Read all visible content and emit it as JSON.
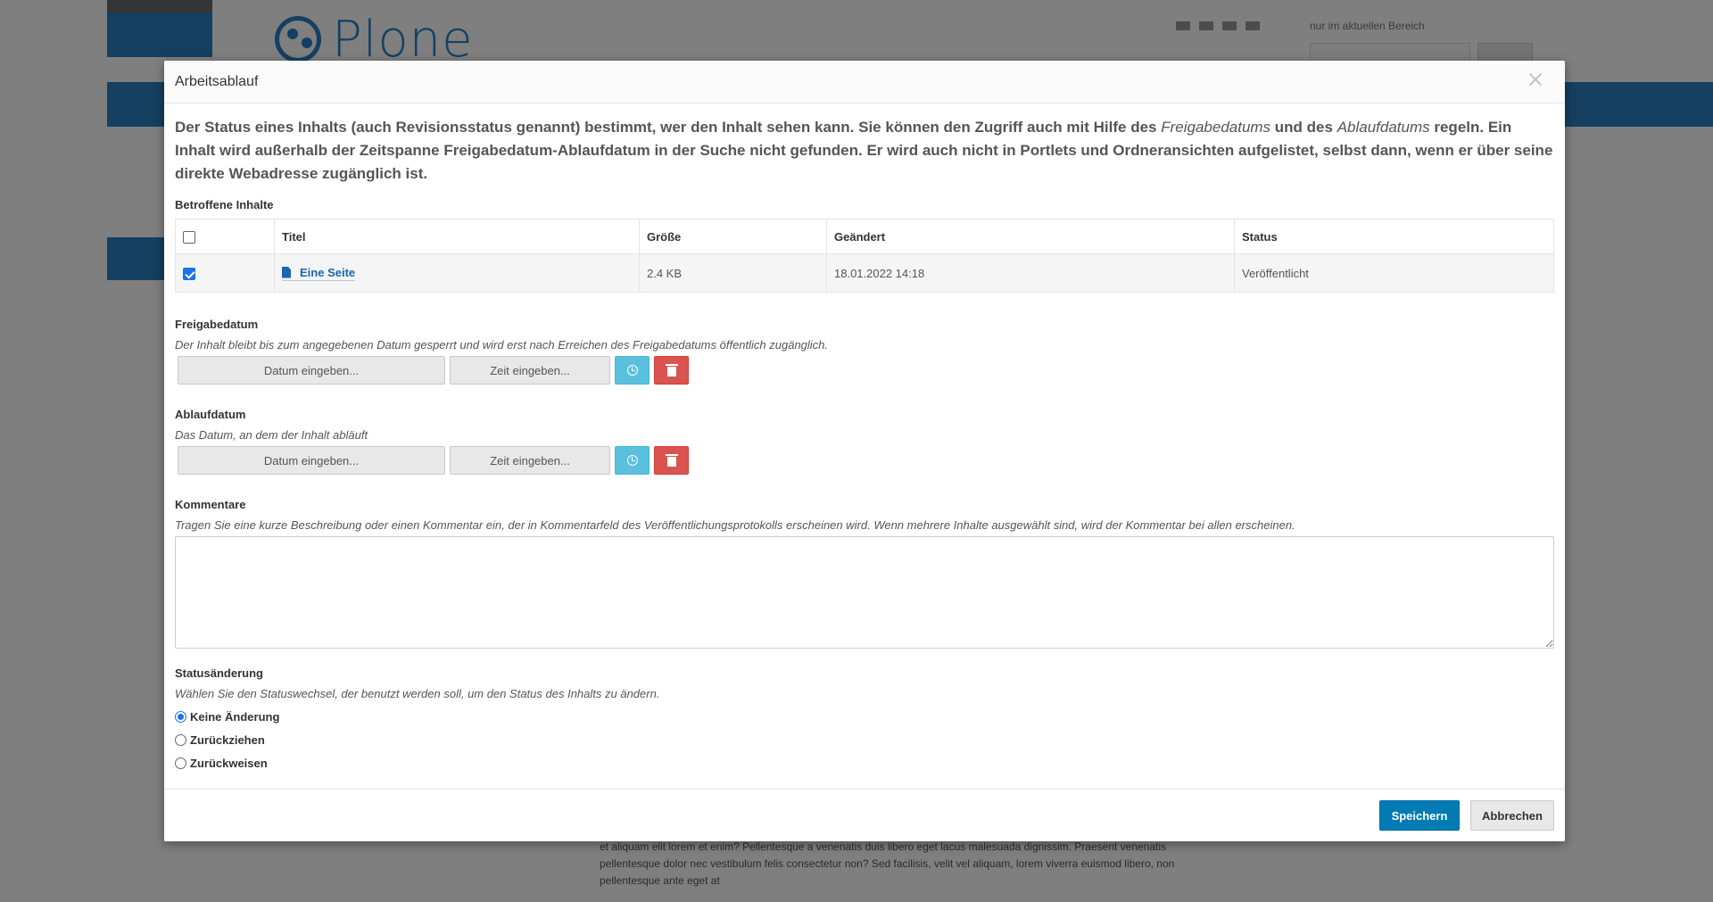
{
  "background": {
    "logo_text": "Plone",
    "site_option_text": "nur im aktuellen Bereich",
    "body_text": "et aliquam elit lorem et enim? Pellentesque a venenatis duis libero eget lacus malesuada dignissim. Praesent venenatis pellentesque dolor nec vestibulum felis consectetur non? Sed facilisis, velit vel aliquam, lorem viverra euismod libero, non pellentesque ante eget at"
  },
  "modal": {
    "title": "Arbeitsablauf",
    "intro_part1": "Der Status eines Inhalts (auch Revisionsstatus genannt) bestimmt, wer den Inhalt sehen kann. Sie können den Zugriff auch mit Hilfe des ",
    "intro_em1": "Freigabedatums",
    "intro_part2": " und des ",
    "intro_em2": "Ablaufdatums",
    "intro_part3": " regeln. Ein Inhalt wird außerhalb der Zeitspanne Freigabedatum-Ablaufdatum in der Suche nicht gefunden. Er wird auch nicht in Portlets und Ordneransichten aufgelistet, selbst dann, wenn er über seine direkte Webadresse zugänglich ist.",
    "affected": {
      "label": "Betroffene Inhalte",
      "columns": [
        "Titel",
        "Größe",
        "Geändert",
        "Status"
      ],
      "rows": [
        {
          "title": "Eine Seite",
          "size": "2.4 KB",
          "modified": "18.01.2022 14:18",
          "status": "Veröffentlicht",
          "checked": true
        }
      ]
    },
    "effective": {
      "label": "Freigabedatum",
      "help": "Der Inhalt bleibt bis zum angegebenen Datum gesperrt und wird erst nach Erreichen des Freigabedatums öffentlich zugänglich.",
      "date_placeholder": "Datum eingeben...",
      "time_placeholder": "Zeit eingeben..."
    },
    "expiration": {
      "label": "Ablaufdatum",
      "help": "Das Datum, an dem der Inhalt abläuft",
      "date_placeholder": "Datum eingeben...",
      "time_placeholder": "Zeit eingeben..."
    },
    "comments": {
      "label": "Kommentare",
      "help": "Tragen Sie eine kurze Beschreibung oder einen Kommentar ein, der in Kommentarfeld des Veröffentlichungsprotokolls erscheinen wird. Wenn mehrere Inhalte ausgewählt sind, wird der Kommentar bei allen erscheinen.",
      "value": ""
    },
    "transition": {
      "label": "Statusänderung",
      "help": "Wählen Sie den Statuswechsel, der benutzt werden soll, um den Status des Inhalts zu ändern.",
      "options": [
        "Keine Änderung",
        "Zurückziehen",
        "Zurückweisen"
      ],
      "selected": "Keine Änderung"
    },
    "footer": {
      "save_label": "Speichern",
      "cancel_label": "Abbrechen"
    }
  },
  "colors": {
    "primary": "#007bb3",
    "info": "#5bc0de",
    "danger": "#d9534f",
    "link": "#1a66b0"
  }
}
